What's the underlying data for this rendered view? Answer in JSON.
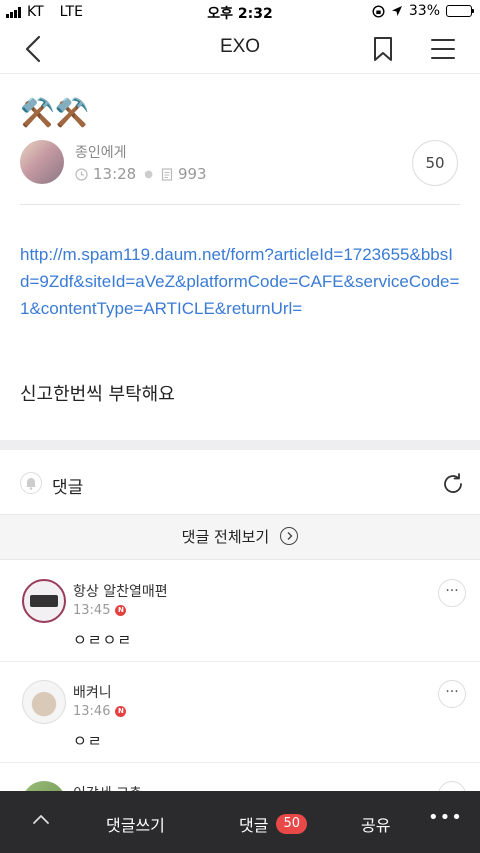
{
  "status_bar": {
    "carrier": "KT",
    "network": "LTE",
    "time": "오후 2:32",
    "battery": "33%",
    "battery_level": 0.33
  },
  "nav": {
    "title": "EXO"
  },
  "article": {
    "emoji": "⚒️⚒️",
    "author": "종인에게",
    "time": "13:28",
    "views": "993",
    "comment_count": "50",
    "link": "http://m.spam119.daum.net/form?articleId=1723655&bbsId=9Zdf&siteId=aVeZ&platformCode=CAFE&serviceCode=1&contentType=ARTICLE&returnUrl=",
    "body": "신고한번씩 부탁해요"
  },
  "comments_section": {
    "header_label": "댓글",
    "view_all_label": "댓글 전체보기",
    "comments": [
      {
        "name": "항상 알찬열매편",
        "time": "13:45",
        "new_badge": "N",
        "text": "ㅇㄹㅇㄹ"
      },
      {
        "name": "배켜니",
        "time": "13:46",
        "new_badge": "N",
        "text": "ㅇㄹ"
      },
      {
        "name": "이갑세 고층",
        "time": "",
        "new_badge": "",
        "text": ""
      }
    ]
  },
  "bottom_bar": {
    "write_label": "댓글쓰기",
    "comment_label": "댓글",
    "comment_count": "50",
    "share_label": "공유",
    "more_label": "•••"
  },
  "colors": {
    "link": "#3a7bd5",
    "badge_red": "#e84848",
    "bottom_bar": "#2b2b2d"
  }
}
